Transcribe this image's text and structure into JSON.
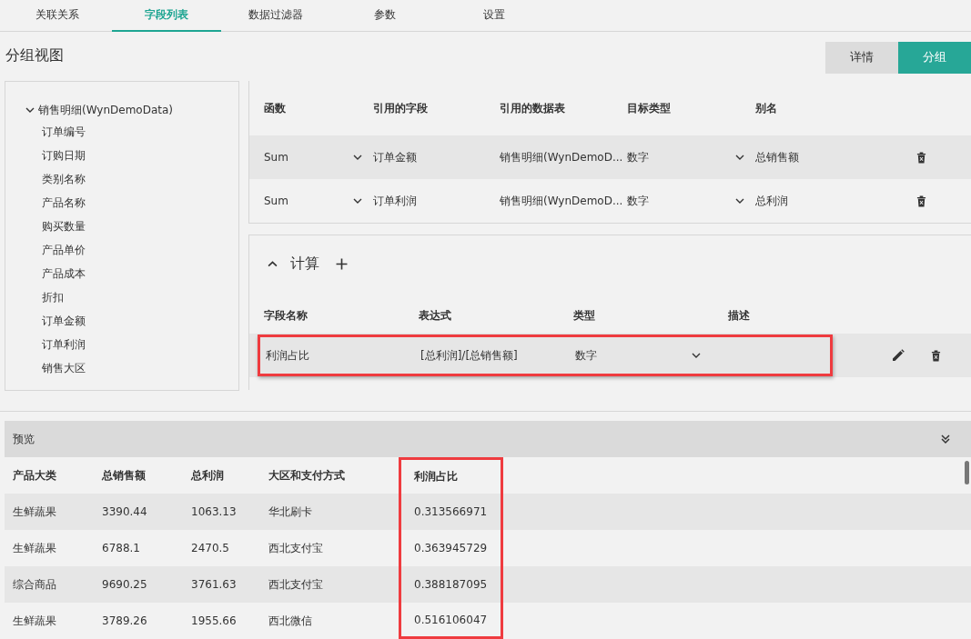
{
  "tabs": [
    {
      "label": "关联关系",
      "selected": false
    },
    {
      "label": "字段列表",
      "selected": true
    },
    {
      "label": "数据过滤器",
      "selected": false
    },
    {
      "label": "参数",
      "selected": false
    },
    {
      "label": "设置",
      "selected": false
    }
  ],
  "view_title": "分组视图",
  "view_buttons": [
    {
      "label": "详情",
      "selected": false
    },
    {
      "label": "分组",
      "selected": true
    }
  ],
  "tree": {
    "label": "销售明细(WynDemoData)",
    "expanded": true,
    "children": [
      {
        "label": "订单编号"
      },
      {
        "label": "订购日期"
      },
      {
        "label": "类别名称"
      },
      {
        "label": "产品名称"
      },
      {
        "label": "购买数量"
      },
      {
        "label": "产品单价"
      },
      {
        "label": "产品成本"
      },
      {
        "label": "折扣"
      },
      {
        "label": "订单金额"
      },
      {
        "label": "订单利润"
      },
      {
        "label": "销售大区"
      }
    ]
  },
  "aggregates": {
    "columns": [
      "函数",
      "引用的字段",
      "引用的数据表",
      "目标类型",
      "别名"
    ],
    "rows": [
      {
        "function": "Sum",
        "field": "订单金额",
        "table": "销售明细(WynDemoD...",
        "type": "数字",
        "alias": "总销售额",
        "hovered": true
      },
      {
        "function": "Sum",
        "field": "订单利润",
        "table": "销售明细(WynDemoD...",
        "type": "数字",
        "alias": "总利润",
        "hovered": false
      }
    ]
  },
  "calculations": {
    "title": "计算",
    "expanded": true,
    "columns": [
      "字段名称",
      "表达式",
      "类型",
      "描述"
    ],
    "rows": [
      {
        "name": "利润占比",
        "expression": "[总利润]/[总销售额]",
        "type": "数字",
        "highlighted": true
      }
    ]
  },
  "preview": {
    "title": "预览",
    "columns": [
      {
        "label": "产品大类",
        "highlighted": false
      },
      {
        "label": "总销售额",
        "highlighted": false
      },
      {
        "label": "总利润",
        "highlighted": false
      },
      {
        "label": "大区和支付方式",
        "highlighted": false
      },
      {
        "label": "利润占比",
        "highlighted": true
      }
    ],
    "rows": [
      [
        "生鲜蔬果",
        "3390.44",
        "1063.13",
        "华北刷卡",
        "0.313566971"
      ],
      [
        "生鲜蔬果",
        "6788.1",
        "2470.5",
        "西北支付宝",
        "0.363945729"
      ],
      [
        "综合商品",
        "9690.25",
        "3761.63",
        "西北支付宝",
        "0.388187095"
      ],
      [
        "生鲜蔬果",
        "3789.26",
        "1955.66",
        "西北微信",
        "0.516106047"
      ]
    ]
  }
}
